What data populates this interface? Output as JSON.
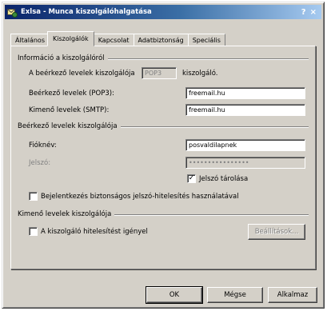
{
  "window": {
    "title": "Exlsa - Munca kiszolgálóhalgatása",
    "help_glyph": "?",
    "close_glyph": "×"
  },
  "tabs": [
    {
      "label": "Általános"
    },
    {
      "label": "Kiszolgálók"
    },
    {
      "label": "Kapcsolat"
    },
    {
      "label": "Adatbiztonság"
    },
    {
      "label": "Speciális"
    }
  ],
  "server_info": {
    "legend": "Információ a kiszolgálóról",
    "incoming_type_label": "A beérkező levelek kiszolgálója",
    "incoming_type_value": "POP3",
    "incoming_type_suffix": "kiszolgáló.",
    "incoming_label": "Beérkező levelek (POP3):",
    "incoming_value": "freemail.hu",
    "outgoing_label": "Kimenő levelek (SMTP):",
    "outgoing_value": "freemail.hu"
  },
  "incoming_server": {
    "legend": "Beérkező levelek kiszolgálója",
    "account_label": "Fióknév:",
    "account_value": "posvaldilapnek",
    "password_label": "Jelszó:",
    "password_value": "••••••••••••••••",
    "remember_label": "Jelszó tárolása",
    "remember_checked": true,
    "spa_label": "Bejelentkezés biztonságos jelszó-hitelesítés használatával",
    "spa_checked": false
  },
  "outgoing_server": {
    "legend": "Kimenő levelek kiszolgálója",
    "auth_label": "A kiszolgáló hitelesítést igényel",
    "auth_checked": false,
    "settings_button": "Beállítások..."
  },
  "buttons": {
    "ok": "OK",
    "cancel": "Mégse",
    "apply": "Alkalmaz"
  }
}
